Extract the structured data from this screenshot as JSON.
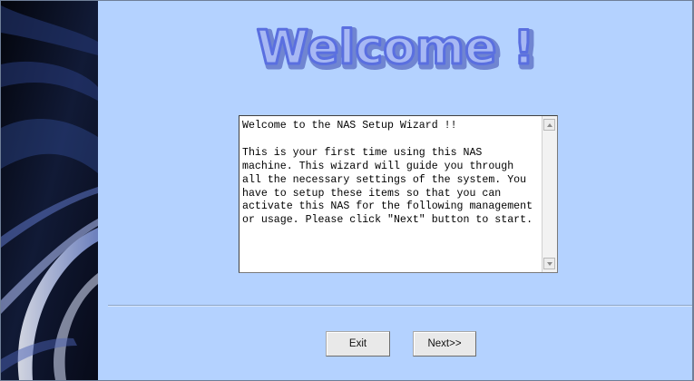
{
  "header": {
    "title": "Welcome !"
  },
  "wizard": {
    "message": "Welcome to the NAS Setup Wizard !!\n\nThis is your first time using this NAS machine. This wizard will guide you through all the necessary settings of the system. You have to setup these items so that you can activate this NAS for the following management or usage. Please click \"Next\" button to start."
  },
  "buttons": {
    "exit_label": "Exit",
    "next_label": "Next>>"
  },
  "colors": {
    "background": "#b4d2ff",
    "title_fill": "#a7b8f4",
    "title_outline": "#5a6fe0",
    "side_panel": "#0d1226"
  },
  "icons": {
    "scroll_up": "triangle-up",
    "scroll_down": "triangle-down"
  }
}
